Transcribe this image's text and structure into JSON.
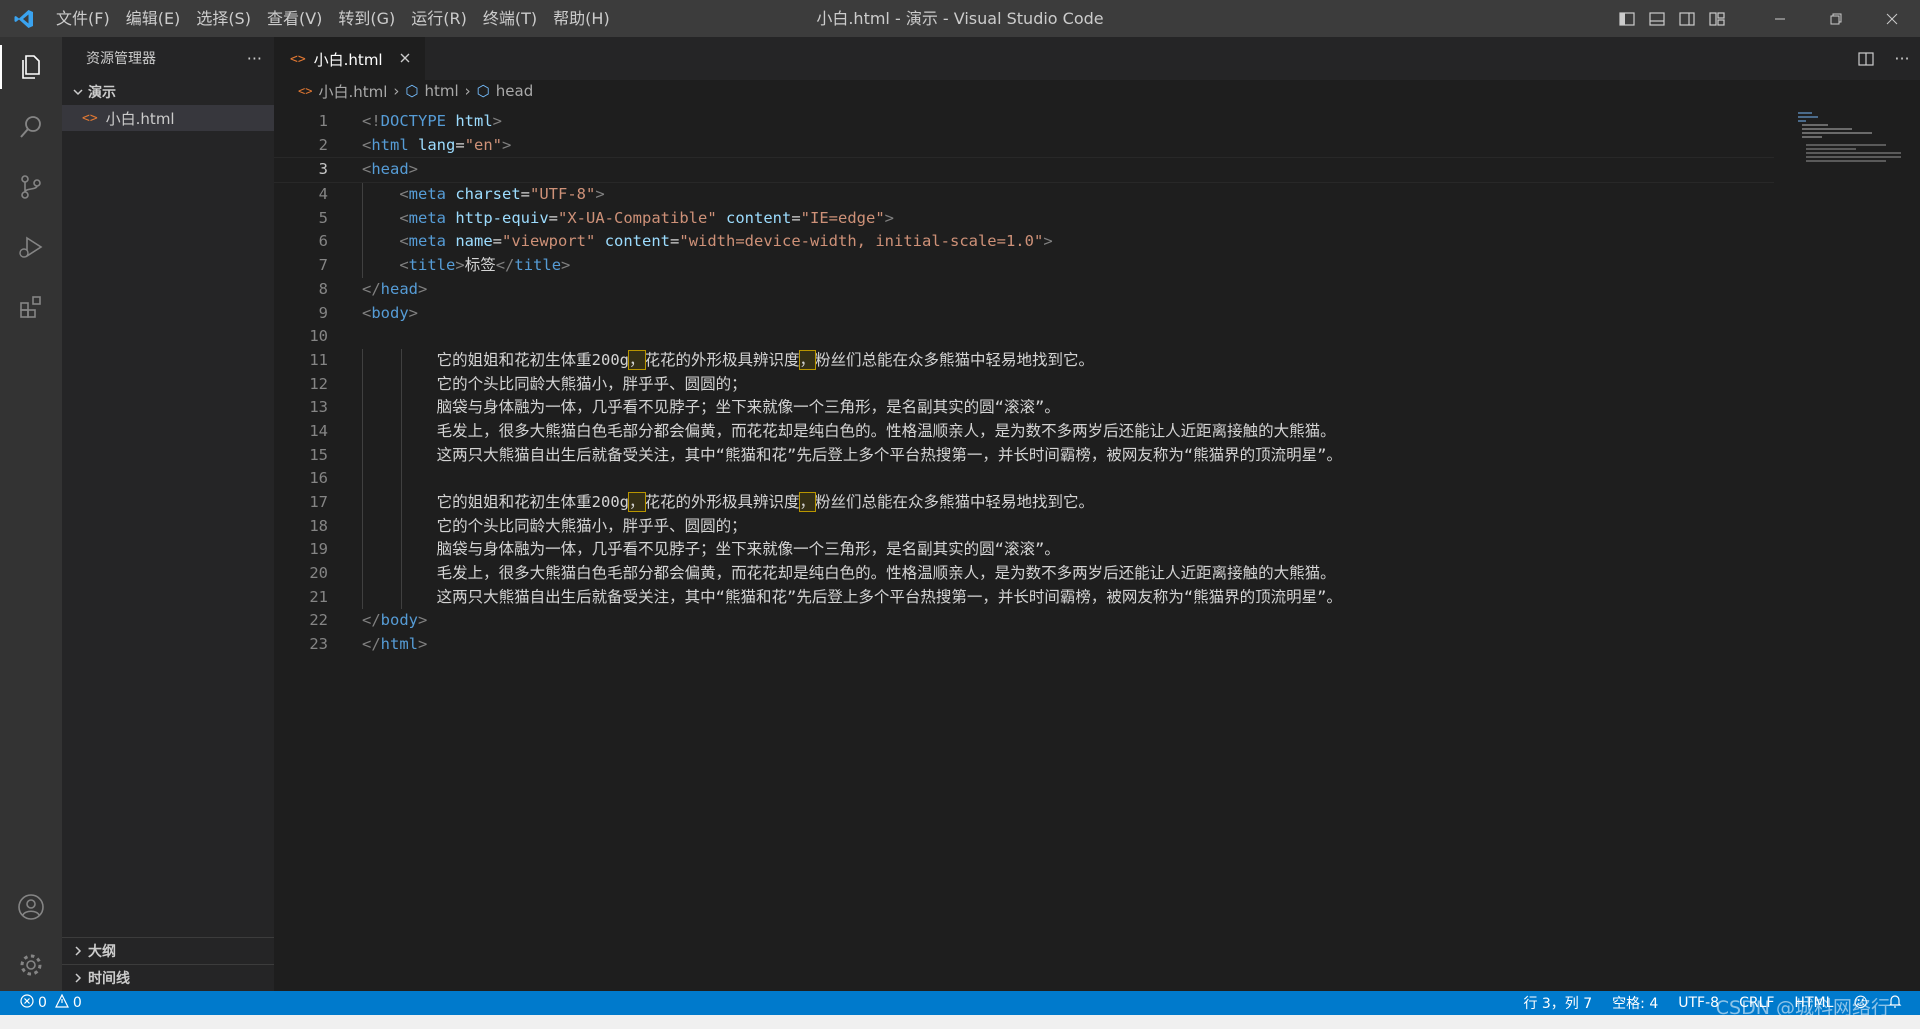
{
  "titlebar": {
    "menu": [
      "文件(F)",
      "编辑(E)",
      "选择(S)",
      "查看(V)",
      "转到(G)",
      "运行(R)",
      "终端(T)",
      "帮助(H)"
    ],
    "title": "小白.html - 演示 - Visual Studio Code"
  },
  "sidebar": {
    "header": "资源管理器",
    "more": "···",
    "folder": "演示",
    "file": "小白.html",
    "outline": "大纲",
    "timeline": "时间线"
  },
  "editor": {
    "tab_label": "小白.html",
    "breadcrumb": [
      "小白.html",
      "html",
      "head"
    ],
    "current_line": 3,
    "lines": [
      "1",
      "2",
      "3",
      "4",
      "5",
      "6",
      "7",
      "8",
      "9",
      "10",
      "11",
      "12",
      "13",
      "14",
      "15",
      "16",
      "17",
      "18",
      "19",
      "20",
      "21",
      "22",
      "23"
    ],
    "code": {
      "doctype_kw": "DOCTYPE",
      "html": "html",
      "lang_attr": "lang",
      "lang_val": "\"en\"",
      "head": "head",
      "meta": "meta",
      "charset_attr": "charset",
      "charset_val": "\"UTF-8\"",
      "httpequiv_attr": "http-equiv",
      "httpequiv_val": "\"X-UA-Compatible\"",
      "content_attr": "content",
      "content_val1": "\"IE=edge\"",
      "name_attr": "name",
      "name_val": "\"viewport\"",
      "content_val2": "\"width=device-width, initial-scale=1.0\"",
      "title": "title",
      "title_text": "标签",
      "body": "body",
      "p1a": "它的姐姐和花初生体重200g",
      "comma": "，",
      "p1b": "花花的外形极具辨识度",
      "p1c": "粉丝们总能在众多熊猫中轻易地找到它。",
      "p2": "它的个头比同龄大熊猫小，胖乎乎、圆圆的；",
      "p3": "脑袋与身体融为一体，几乎看不见脖子；坐下来就像一个三角形，是名副其实的圆“滚滚”。",
      "p4": "毛发上，很多大熊猫白色毛部分都会偏黄，而花花却是纯白色的。性格温顺亲人，是为数不多两岁后还能让人近距离接触的大熊猫。",
      "p5": "这两只大熊猫自出生后就备受关注，其中“熊猫和花”先后登上多个平台热搜第一，并长时间霸榜，被网友称为“熊猫界的顶流明星”。"
    }
  },
  "statusbar": {
    "errors": "0",
    "warnings": "0",
    "position": "行 3，列 7",
    "spaces": "空格: 4",
    "encoding": "UTF-8",
    "eol": "CRLF",
    "language": "HTML"
  },
  "watermark": "CSDN @城科网络行",
  "colors": {
    "accent": "#007acc",
    "tag": "#569cd6",
    "attribute": "#9cdcfe",
    "string": "#ce9178"
  }
}
